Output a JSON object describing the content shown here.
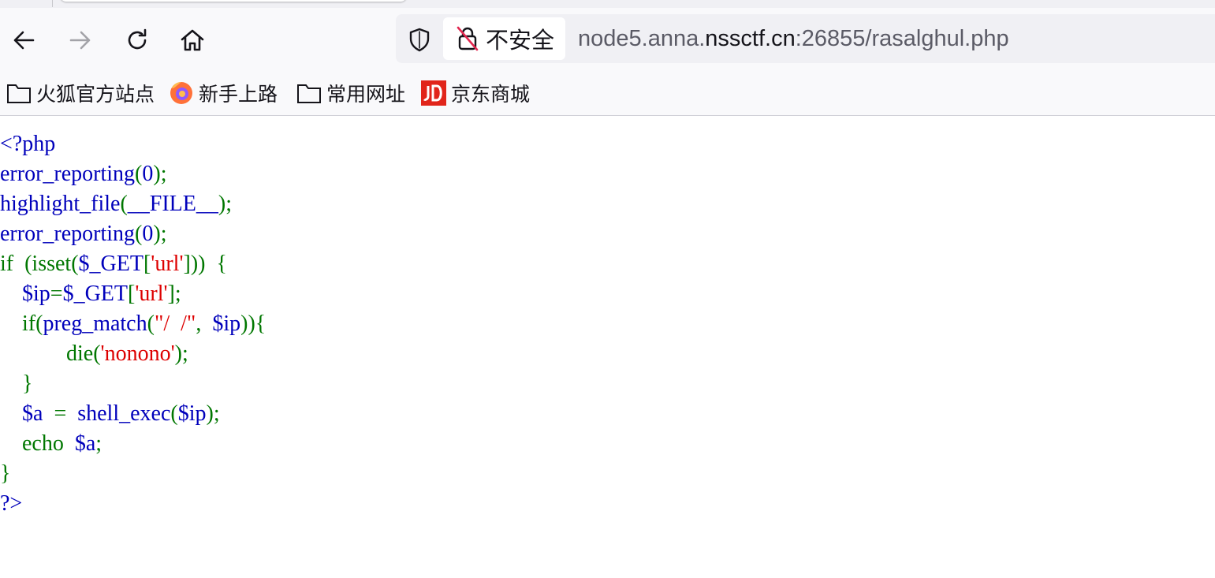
{
  "toolbar": {
    "back_icon": "arrow-left-icon",
    "forward_icon": "arrow-right-icon",
    "reload_icon": "reload-icon",
    "home_icon": "home-icon"
  },
  "urlbar": {
    "security_icon": "shield-icon",
    "insecure_icon": "broken-lock-icon",
    "insecure_label": "不安全",
    "url_prefix": "node5.anna.",
    "url_domain": "nssctf.cn",
    "url_suffix": ":26855/rasalghul.php"
  },
  "bookmarks": [
    {
      "label": "火狐官方站点",
      "icon": "folder-icon"
    },
    {
      "label": "新手上路",
      "icon": "firefox-icon"
    },
    {
      "label": "常用网址",
      "icon": "folder-icon"
    },
    {
      "label": "京东商城",
      "icon": "jd-icon"
    }
  ],
  "colors": {
    "php_default": "#0000BB",
    "php_keyword": "#007700",
    "php_string": "#DD0000"
  },
  "code": {
    "lines": [
      [
        {
          "t": "<?php",
          "c": "default"
        }
      ],
      [
        {
          "t": "error_reporting",
          "c": "default"
        },
        {
          "t": "(",
          "c": "keyword"
        },
        {
          "t": "0",
          "c": "default"
        },
        {
          "t": ");",
          "c": "keyword"
        }
      ],
      [
        {
          "t": "highlight_file",
          "c": "default"
        },
        {
          "t": "(",
          "c": "keyword"
        },
        {
          "t": "__FILE__",
          "c": "default"
        },
        {
          "t": ");",
          "c": "keyword"
        }
      ],
      [
        {
          "t": "error_reporting",
          "c": "default"
        },
        {
          "t": "(",
          "c": "keyword"
        },
        {
          "t": "0",
          "c": "default"
        },
        {
          "t": ");",
          "c": "keyword"
        }
      ],
      [
        {
          "t": "if  (isset(",
          "c": "keyword"
        },
        {
          "t": "$_GET",
          "c": "default"
        },
        {
          "t": "[",
          "c": "keyword"
        },
        {
          "t": "'url'",
          "c": "string"
        },
        {
          "t": "]))  {",
          "c": "keyword"
        }
      ],
      [
        {
          "t": "    ",
          "c": "keyword"
        },
        {
          "t": "$ip",
          "c": "default"
        },
        {
          "t": "=",
          "c": "keyword"
        },
        {
          "t": "$_GET",
          "c": "default"
        },
        {
          "t": "[",
          "c": "keyword"
        },
        {
          "t": "'url'",
          "c": "string"
        },
        {
          "t": "];",
          "c": "keyword"
        }
      ],
      [
        {
          "t": "    if(",
          "c": "keyword"
        },
        {
          "t": "preg_match",
          "c": "default"
        },
        {
          "t": "(",
          "c": "keyword"
        },
        {
          "t": "\"/  /\"",
          "c": "string"
        },
        {
          "t": ",  ",
          "c": "keyword"
        },
        {
          "t": "$ip",
          "c": "default"
        },
        {
          "t": ")){",
          "c": "keyword"
        }
      ],
      [
        {
          "t": "            die(",
          "c": "keyword"
        },
        {
          "t": "'nonono'",
          "c": "string"
        },
        {
          "t": ");",
          "c": "keyword"
        }
      ],
      [
        {
          "t": "    }",
          "c": "keyword"
        }
      ],
      [
        {
          "t": "    ",
          "c": "keyword"
        },
        {
          "t": "$a  ",
          "c": "default"
        },
        {
          "t": "=  ",
          "c": "keyword"
        },
        {
          "t": "shell_exec",
          "c": "default"
        },
        {
          "t": "(",
          "c": "keyword"
        },
        {
          "t": "$ip",
          "c": "default"
        },
        {
          "t": ");",
          "c": "keyword"
        }
      ],
      [
        {
          "t": "    echo  ",
          "c": "keyword"
        },
        {
          "t": "$a",
          "c": "default"
        },
        {
          "t": ";",
          "c": "keyword"
        }
      ],
      [
        {
          "t": "}",
          "c": "keyword"
        }
      ],
      [
        {
          "t": "?>",
          "c": "default"
        }
      ]
    ]
  }
}
